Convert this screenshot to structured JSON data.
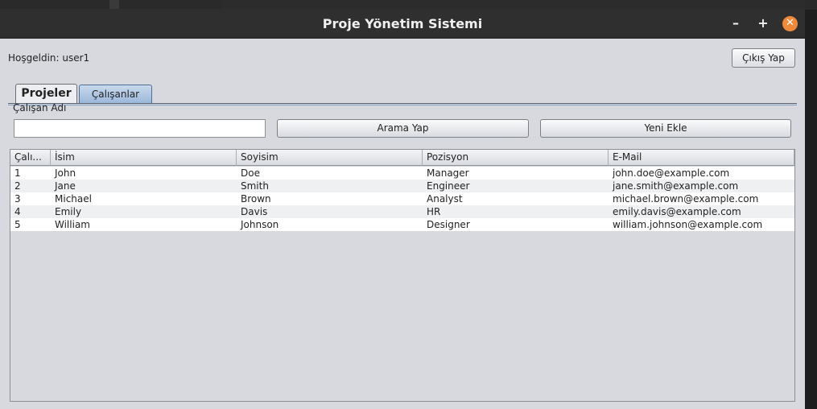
{
  "window": {
    "title": "Proje Yönetim Sistemi",
    "minimize_glyph": "–",
    "maximize_glyph": "+",
    "close_glyph": "✕"
  },
  "header": {
    "welcome": "Hoşgeldin: user1",
    "logout_label": "Çıkış Yap"
  },
  "tabs": [
    {
      "label": "Projeler",
      "selected": false
    },
    {
      "label": "Çalışanlar",
      "selected": true
    }
  ],
  "search": {
    "label": "Çalışan Adı",
    "value": "",
    "search_button": "Arama Yap",
    "add_button": "Yeni Ekle"
  },
  "table": {
    "columns": [
      "Çalı...",
      "İsim",
      "Soyisim",
      "Pozisyon",
      "E-Mail"
    ],
    "rows": [
      [
        "1",
        "John",
        "Doe",
        "Manager",
        "john.doe@example.com"
      ],
      [
        "2",
        "Jane",
        "Smith",
        "Engineer",
        "jane.smith@example.com"
      ],
      [
        "3",
        "Michael",
        "Brown",
        "Analyst",
        "michael.brown@example.com"
      ],
      [
        "4",
        "Emily",
        "Davis",
        "HR",
        "emily.davis@example.com"
      ],
      [
        "5",
        "William",
        "Johnson",
        "Designer",
        "william.johnson@example.com"
      ]
    ]
  },
  "colors": {
    "window_bg": "#d7d9df",
    "titlebar_bg": "#2f2f2f",
    "close_button": "#f08a3b",
    "selected_tab": "#9ab8da"
  }
}
